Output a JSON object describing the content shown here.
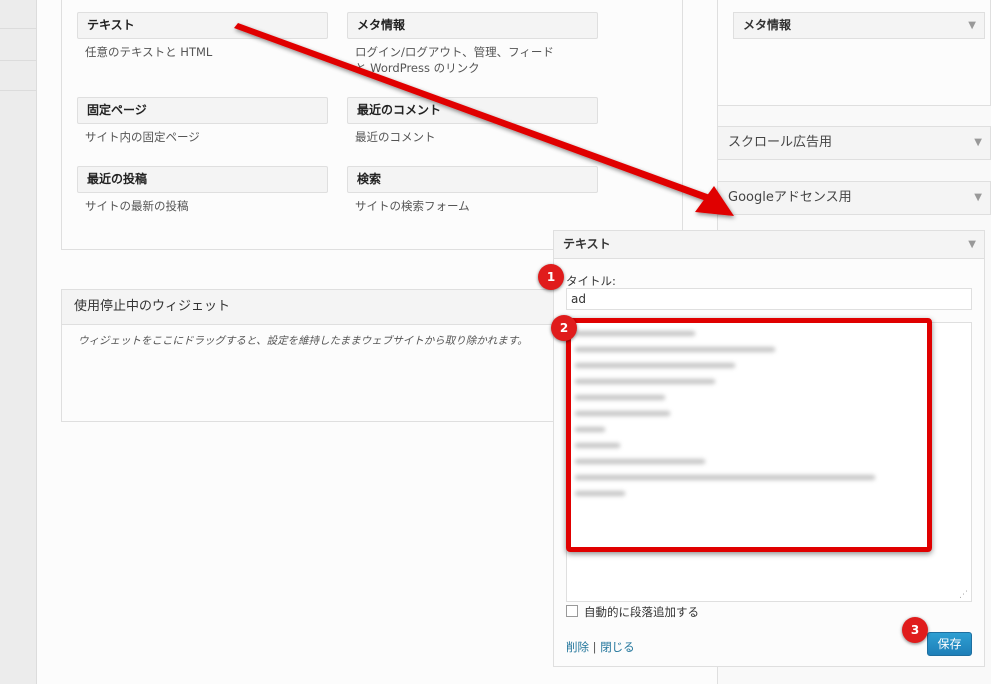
{
  "available_widgets": [
    {
      "title": "テキスト",
      "desc": "任意のテキストと HTML"
    },
    {
      "title": "メタ情報",
      "desc": "ログイン/ログアウト、管理、フィードと WordPress のリンク"
    },
    {
      "title": "固定ページ",
      "desc": "サイト内の固定ページ"
    },
    {
      "title": "最近のコメント",
      "desc": "最近のコメント"
    },
    {
      "title": "最近の投稿",
      "desc": "サイトの最新の投稿"
    },
    {
      "title": "検索",
      "desc": "サイトの検索フォーム"
    }
  ],
  "inactive": {
    "title": "使用停止中のウィジェット",
    "desc": "ウィジェットをここにドラッグすると、設定を維持したままウェブサイトから取り除かれます。"
  },
  "sidebar": {
    "meta_widget": "メタ情報",
    "areas": [
      "スクロール広告用",
      "Googleアドセンス用"
    ]
  },
  "text_widget": {
    "title": "テキスト",
    "title_label": "タイトル:",
    "title_value": "ad",
    "autop_label": "自動的に段落追加する",
    "delete_label": "削除",
    "separator": "|",
    "close_label": "閉じる",
    "save_label": "保存"
  },
  "callouts": [
    "1",
    "2",
    "3"
  ],
  "colors": {
    "annotation_red": "#e00000",
    "link_blue": "#21759b",
    "button_blue": "#2e9fd2"
  }
}
